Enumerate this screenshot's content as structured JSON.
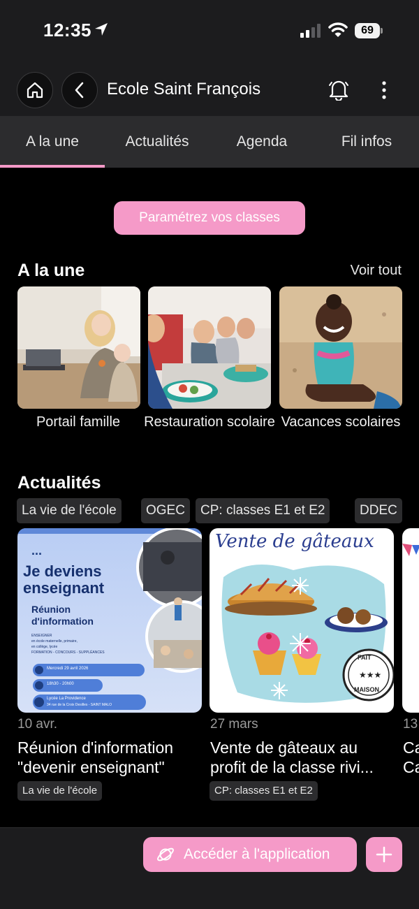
{
  "status_bar": {
    "time": "12:35",
    "battery": "69"
  },
  "header": {
    "title": "Ecole Saint François"
  },
  "tabs": [
    {
      "label": "A la une"
    },
    {
      "label": "Actualités"
    },
    {
      "label": "Agenda"
    },
    {
      "label": "Fil infos"
    }
  ],
  "params_button": "Paramétrez vos classes",
  "featured": {
    "title": "A la une",
    "see_all": "Voir tout",
    "cards": [
      {
        "label": "Portail famille"
      },
      {
        "label": "Restauration scolaire"
      },
      {
        "label": "Vacances scolaires"
      }
    ]
  },
  "news": {
    "title": "Actualités",
    "filters": [
      "La vie de l'école",
      "OGEC",
      "CP: classes E1 et  E2",
      "DDEC"
    ],
    "poster1": {
      "headline": "Je deviens enseignant",
      "sub": "Réunion d'information",
      "lines": [
        "ENSEIGNER",
        "en école maternelle, primaire,",
        "en collège, lycée",
        "FORMATION - CONCOURS - SUPPLÉANCES"
      ],
      "date": "Mercredi 29 avril 2026",
      "hours": "18h30 - 20h00",
      "place": "Lycée La Providence",
      "address": "34 rue de la Croix Desilles - SAINT MALO"
    },
    "poster2": {
      "headline": "Vente de gâteaux",
      "stamp_top": "FAIT",
      "stamp_bottom": "MAISON"
    },
    "items": [
      {
        "date": "10 avr.",
        "title_line1": "Réunion d'information",
        "title_line2": "\"devenir enseignant\"",
        "tag": "La vie de l'école"
      },
      {
        "date": "27 mars",
        "title_line1": "Vente de gâteaux au",
        "title_line2": "profit de la classe rivi...",
        "tag": "CP: classes E1 et  E2"
      },
      {
        "date": "13",
        "title_line1": "Ca",
        "title_line2": "Ca"
      }
    ]
  },
  "bottom": {
    "app_button": "Accéder à l'application"
  },
  "colors": {
    "accent": "#f59ac8",
    "background": "#000000",
    "surface": "#1c1c1e"
  },
  "icons": [
    "location-arrow-icon",
    "signal-icon",
    "wifi-icon",
    "home-icon",
    "back-icon",
    "bell-icon",
    "more-icon",
    "planet-icon",
    "plus-icon"
  ]
}
